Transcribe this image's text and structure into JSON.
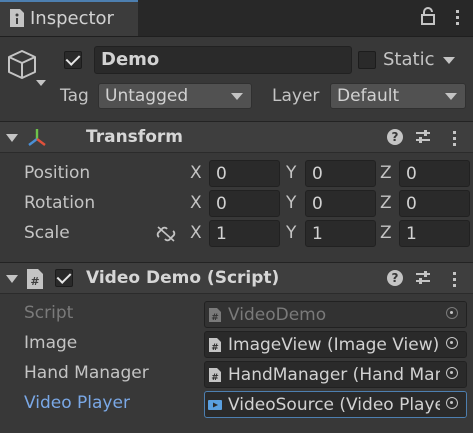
{
  "tab": {
    "label": "Inspector",
    "icon": "info-icon"
  },
  "header": {
    "name": "Demo",
    "static_label": "Static",
    "tag_label": "Tag",
    "tag_value": "Untagged",
    "layer_label": "Layer",
    "layer_value": "Default"
  },
  "transform": {
    "title": "Transform",
    "rows": [
      {
        "label": "Position",
        "x": "0",
        "y": "0",
        "z": "0"
      },
      {
        "label": "Rotation",
        "x": "0",
        "y": "0",
        "z": "0"
      },
      {
        "label": "Scale",
        "x": "1",
        "y": "1",
        "z": "1"
      }
    ],
    "axes": [
      "X",
      "Y",
      "Z"
    ]
  },
  "script": {
    "title": "Video Demo (Script)",
    "fields": [
      {
        "label": "Script",
        "value": "VideoDemo"
      },
      {
        "label": "Image",
        "value": "ImageView (Image View)"
      },
      {
        "label": "Hand Manager",
        "value": "HandManager (Hand Manager)"
      },
      {
        "label": "Video Player",
        "value": "VideoSource (Video Player)"
      }
    ]
  },
  "colors": {
    "accent": "#4d7fb0",
    "link_label": "#7aa8e6"
  }
}
